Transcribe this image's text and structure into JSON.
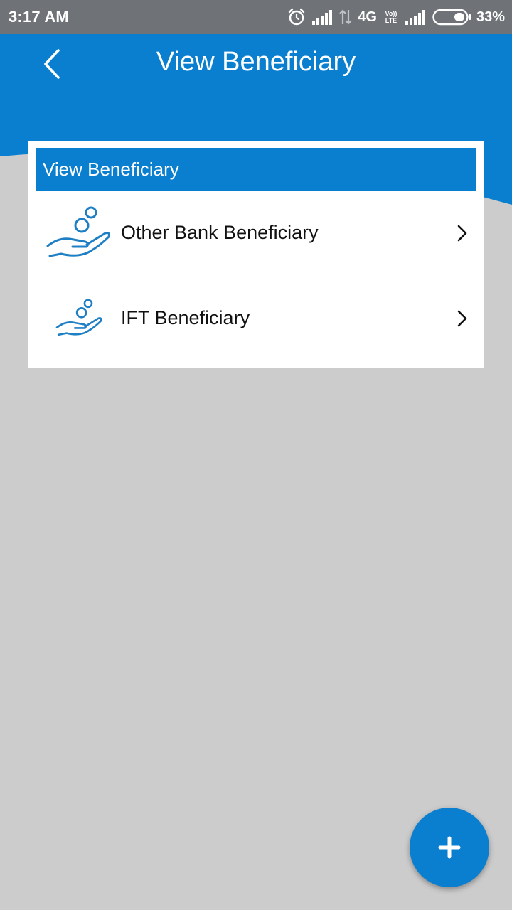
{
  "status_bar": {
    "time": "3:17 AM",
    "network": "4G",
    "volte_top": "Vo))",
    "volte_bottom": "LTE",
    "battery_percent": "33%",
    "icons": [
      "alarm-icon",
      "signal-icon",
      "data-arrows-icon",
      "volte-icon",
      "signal-icon",
      "battery-icon"
    ]
  },
  "header": {
    "title": "View Beneficiary",
    "back_icon": "chevron-left-icon"
  },
  "card": {
    "title": "View Beneficiary",
    "items": [
      {
        "label": "Other Bank Beneficiary",
        "icon": "hand-coins-icon",
        "action_icon": "chevron-right-icon"
      },
      {
        "label": "IFT Beneficiary",
        "icon": "hand-coins-icon",
        "action_icon": "chevron-right-icon"
      }
    ]
  },
  "fab": {
    "icon": "plus-icon"
  },
  "colors": {
    "primary": "#0b7fcf",
    "status_bar": "#6f7378",
    "background": "#cccccc",
    "card": "#ffffff",
    "icon_blue": "#1f7fc4"
  }
}
